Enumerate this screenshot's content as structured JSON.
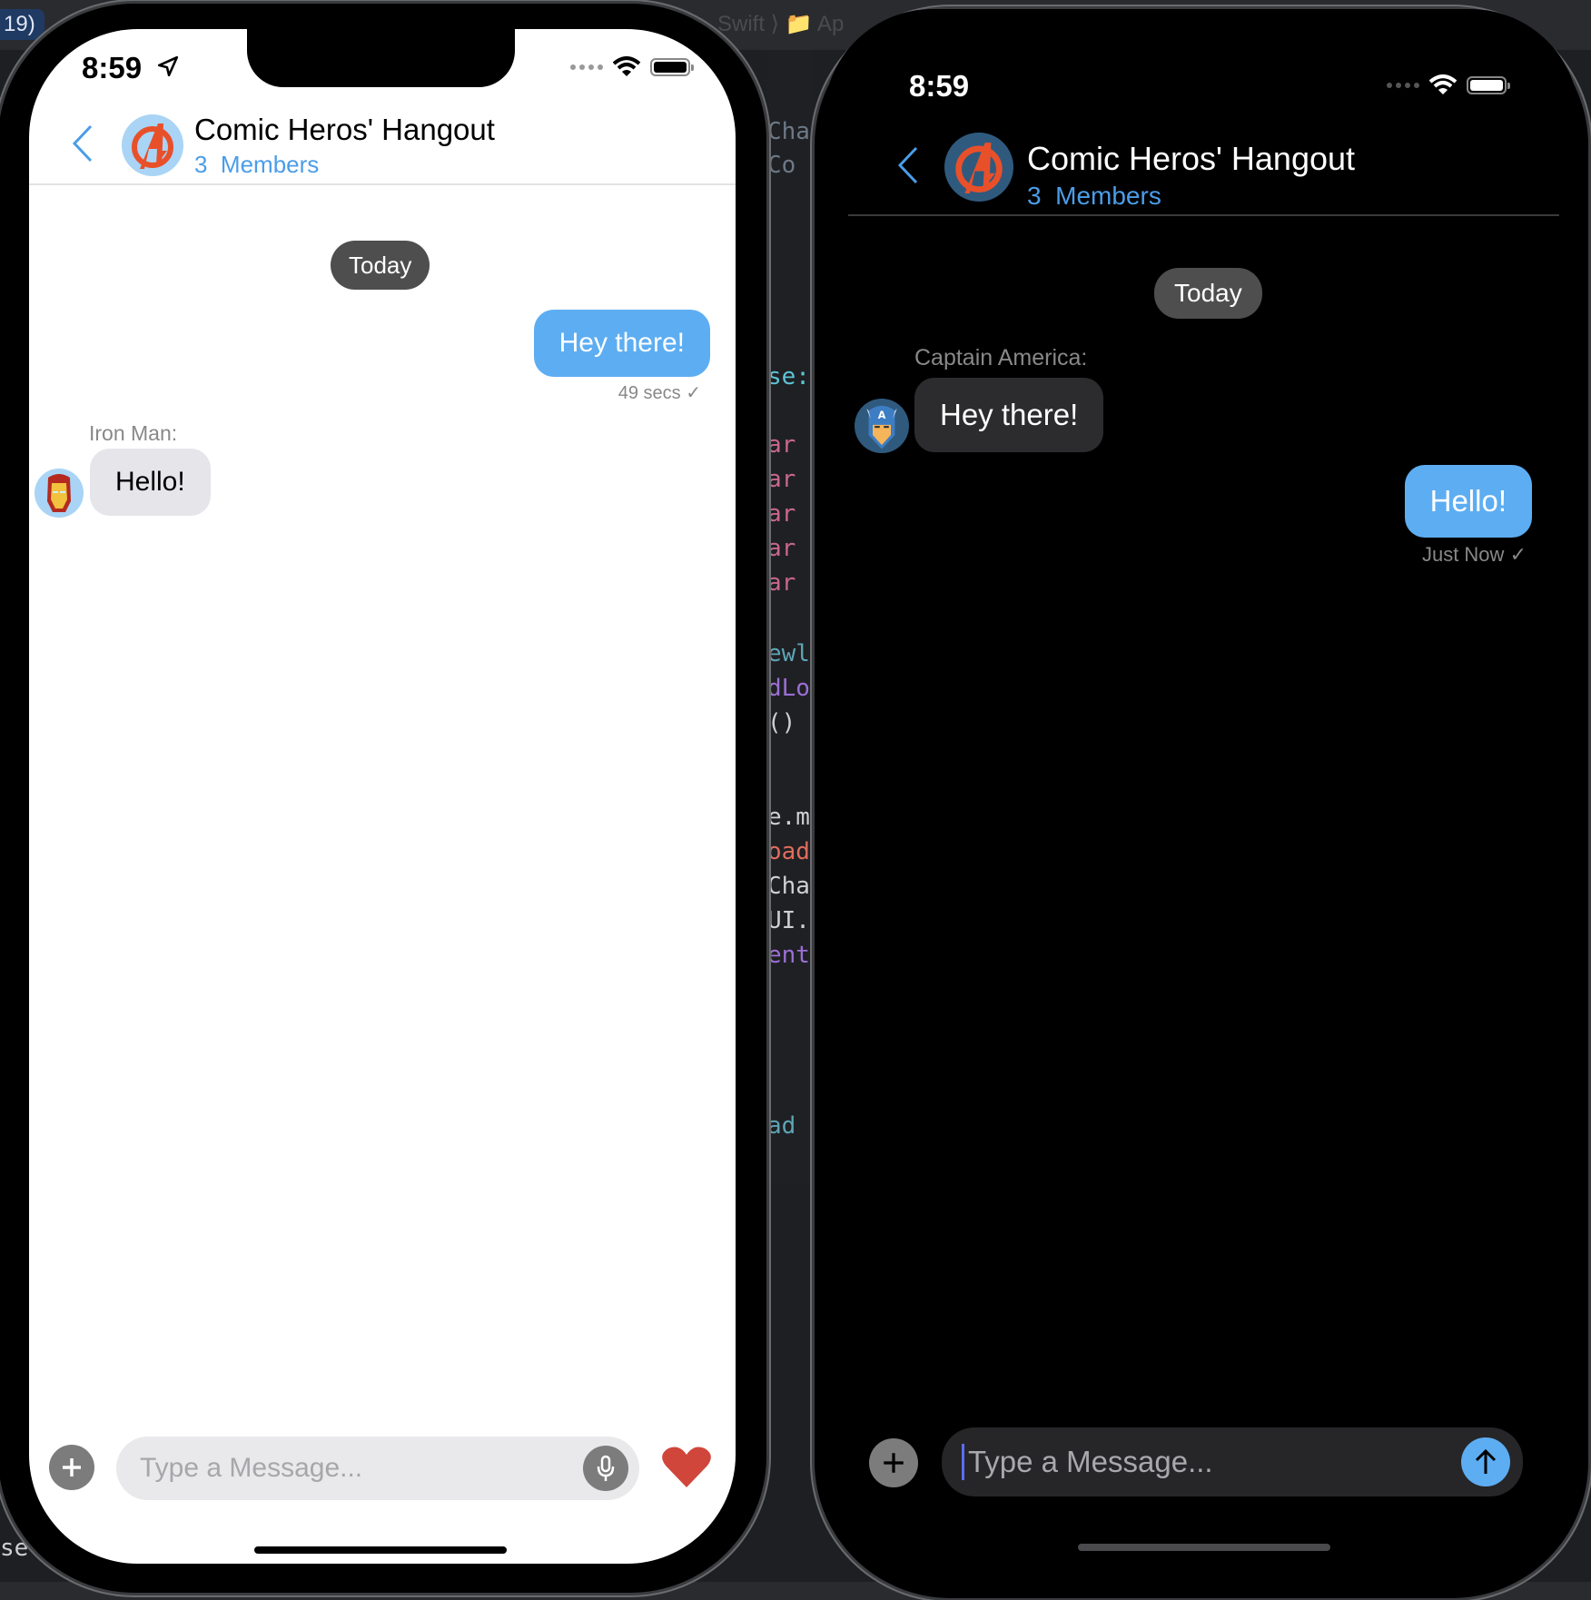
{
  "background": {
    "xcode_badge": "19)",
    "breadcrumb": "Swift ⟩ 📁 Ap",
    "code_fragments": [
      {
        "text": "Cha",
        "color": "#6c7986"
      },
      {
        "text": " Co",
        "color": "#6c7986"
      },
      {
        "text": "se:",
        "color": "#5dc3d6"
      },
      {
        "text": "ar",
        "color": "#c9678a"
      },
      {
        "text": "ar",
        "color": "#c9678a"
      },
      {
        "text": "ar",
        "color": "#c9678a"
      },
      {
        "text": "ar",
        "color": "#c9678a"
      },
      {
        "text": "ar",
        "color": "#c9678a"
      },
      {
        "text": "ewl",
        "color": "#5da5b5"
      },
      {
        "text": "dLo",
        "color": "#9b6fd4"
      },
      {
        "text": "()",
        "color": "#cfcfcf"
      },
      {
        "text": "e.m",
        "color": "#cfcfcf"
      },
      {
        "text": "oad",
        "color": "#e06c5c"
      },
      {
        "text": "Cha",
        "color": "#cfcfcf"
      },
      {
        "text": "UI.",
        "color": "#cfcfcf"
      },
      {
        "text": "ent",
        "color": "#9b6fd4"
      },
      {
        "text": " ad",
        "color": "#5da5b5"
      }
    ],
    "left_code": "set("
  },
  "colors": {
    "accent": "#4b9de8",
    "outgoing_bubble": "#5dadf2",
    "incoming_bubble_light": "#e5e5ea",
    "incoming_bubble_dark": "#2c2c2e",
    "heart": "#d0463b"
  },
  "light": {
    "status": {
      "time": "8:59",
      "location_icon": "location-arrow-icon"
    },
    "header": {
      "back_icon": "chevron-left-icon",
      "title": "Comic Heros' Hangout",
      "member_count": "3",
      "member_label": "Members"
    },
    "date_pill": "Today",
    "messages": [
      {
        "direction": "outgoing",
        "text": "Hey there!",
        "meta": "49 secs",
        "status_icon": "checkmark-icon"
      },
      {
        "direction": "incoming",
        "sender": "Iron Man:",
        "text": "Hello!",
        "avatar": "iron-man-avatar"
      }
    ],
    "input": {
      "placeholder": "Type a Message...",
      "value": "",
      "left_icon": "plus-icon",
      "mic_icon": "microphone-icon",
      "right_icon": "heart-icon"
    }
  },
  "dark": {
    "status": {
      "time": "8:59"
    },
    "header": {
      "back_icon": "chevron-left-icon",
      "title": "Comic Heros' Hangout",
      "member_count": "3",
      "member_label": "Members"
    },
    "date_pill": "Today",
    "messages": [
      {
        "direction": "incoming",
        "sender": "Captain America:",
        "text": "Hey there!",
        "avatar": "captain-america-avatar"
      },
      {
        "direction": "outgoing",
        "text": "Hello!",
        "meta": "Just Now",
        "status_icon": "checkmark-icon"
      }
    ],
    "input": {
      "placeholder": "Type a Message...",
      "value": "",
      "left_icon": "plus-icon",
      "send_icon": "arrow-up-icon"
    }
  }
}
